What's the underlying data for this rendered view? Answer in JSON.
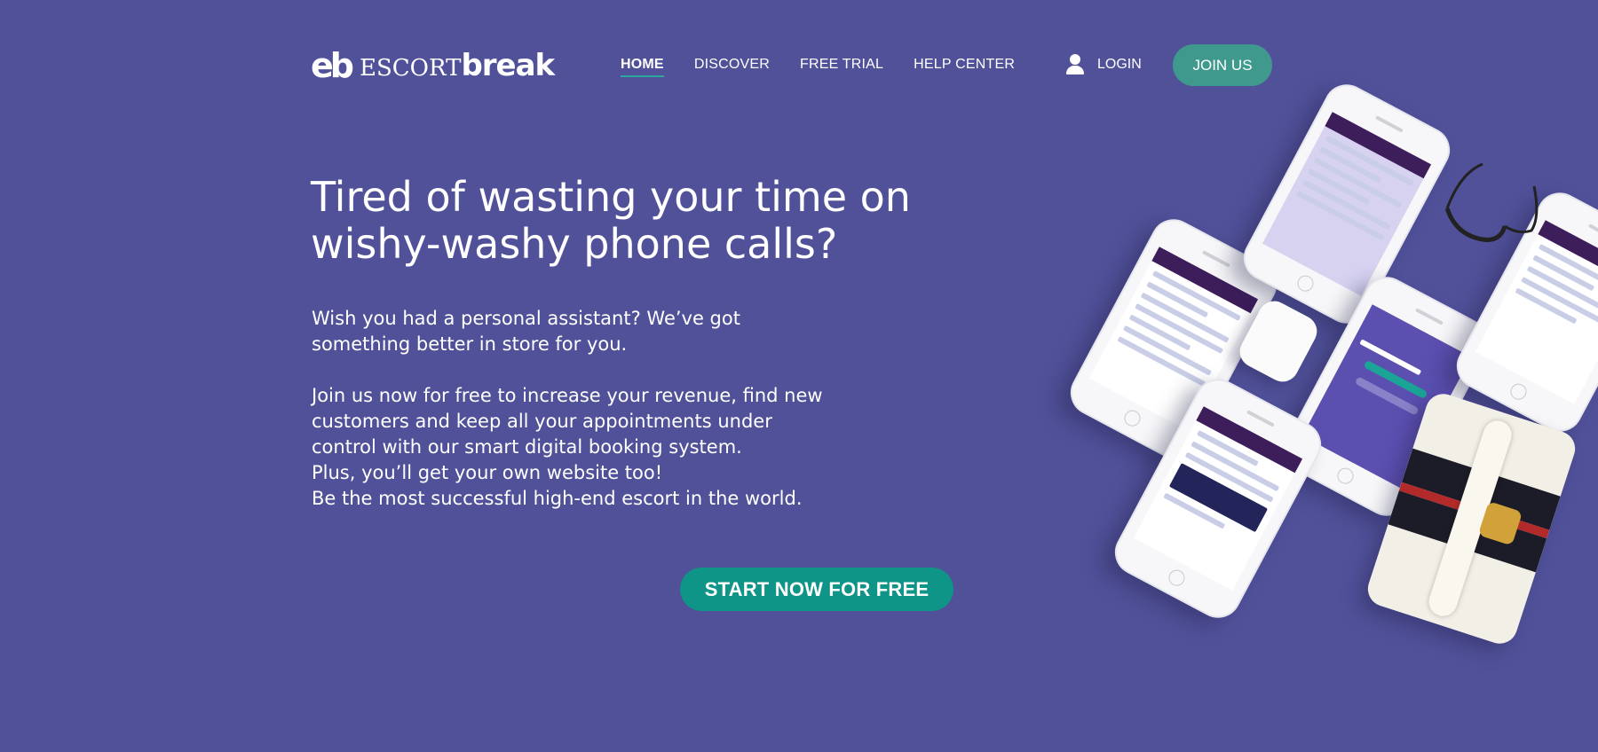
{
  "brand": {
    "logo_mark": "eb",
    "logo_escort": "ESCORT",
    "logo_break": "break"
  },
  "nav": {
    "items": [
      {
        "label": "HOME",
        "active": true
      },
      {
        "label": "DISCOVER",
        "active": false
      },
      {
        "label": "FREE TRIAL",
        "active": false
      },
      {
        "label": "HELP CENTER",
        "active": false
      }
    ]
  },
  "header": {
    "login_label": "LOGIN",
    "join_label": "JOIN US",
    "user_icon": "user-icon"
  },
  "hero": {
    "headline_line1": "Tired of wasting your time on",
    "headline_line2": "wishy-washy phone calls?",
    "intro_line1": "Wish you had a personal assistant? We’ve got",
    "intro_line2": "something better in store for you.",
    "body_lines": [
      "Join us now for free to increase your revenue, find new",
      "customers and keep all your appointments under",
      "control with our smart digital booking system.",
      "Plus, you’ll get your own website too!",
      "Be the most successful high-end escort in the world."
    ],
    "cta_label": "START NOW FOR FREE"
  },
  "colors": {
    "background": "#51519a",
    "accent_teal": "#0f9488",
    "join_button": "#3f9a8d"
  }
}
